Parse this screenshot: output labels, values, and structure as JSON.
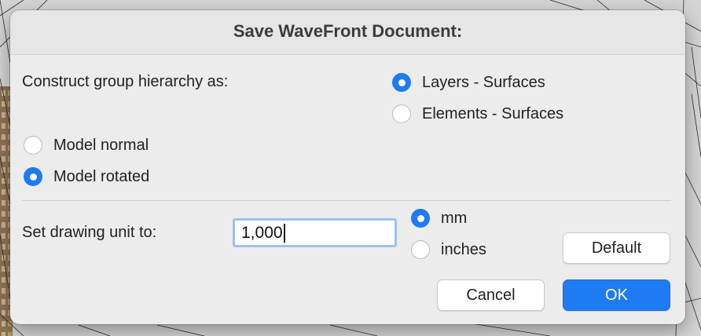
{
  "dialog": {
    "title": "Save WaveFront Document:",
    "group_hierarchy": {
      "label": "Construct group hierarchy as:",
      "options": [
        {
          "label": "Layers - Surfaces",
          "selected": true
        },
        {
          "label": "Elements - Surfaces",
          "selected": false
        }
      ]
    },
    "model_orientation": {
      "options": [
        {
          "label": "Model normal",
          "selected": false
        },
        {
          "label": "Model rotated",
          "selected": true
        }
      ]
    },
    "drawing_unit": {
      "label": "Set drawing unit to:",
      "value": "1,000",
      "unit_options": [
        {
          "label": "mm",
          "selected": true
        },
        {
          "label": "inches",
          "selected": false
        }
      ]
    },
    "buttons": {
      "default": "Default",
      "cancel": "Cancel",
      "ok": "OK"
    }
  },
  "colors": {
    "accent": "#1f7bf3",
    "dialog_background": "#ececec"
  }
}
